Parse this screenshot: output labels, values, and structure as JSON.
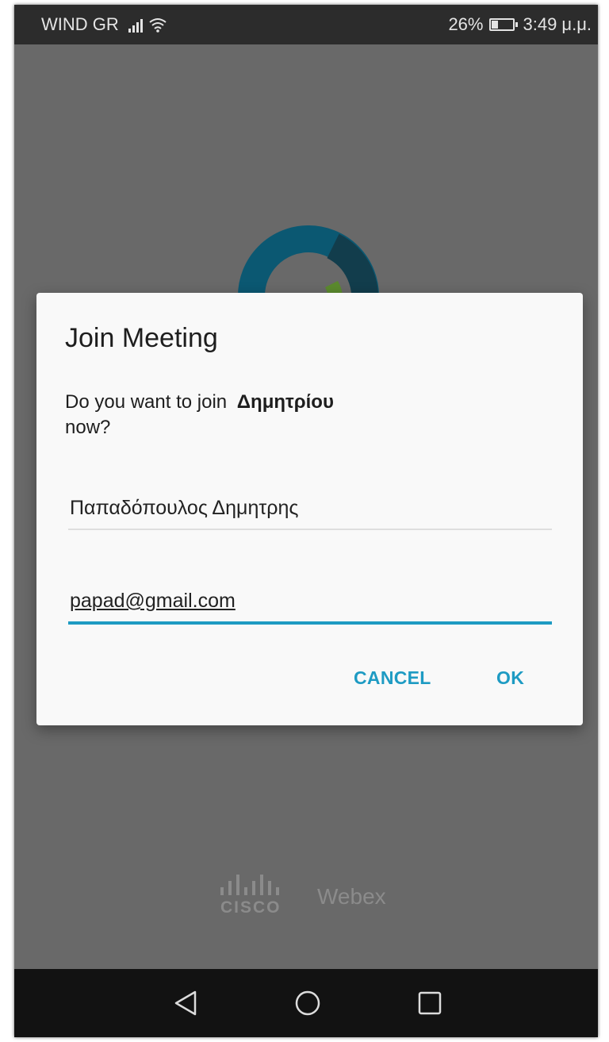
{
  "status_bar": {
    "carrier": "WIND GR",
    "battery_percent": "26%",
    "time": "3:49 μ.μ.",
    "icons": [
      "signal-icon",
      "wifi-icon",
      "battery-icon"
    ]
  },
  "dialog": {
    "title": "Join Meeting",
    "message_prefix": "Do you want to join",
    "meeting_name": "Δημητρίου",
    "message_suffix": "now?",
    "name_value": "Παπαδόπουλος Δημητρης",
    "email_value": "papad@gmail.com",
    "cancel_label": "CANCEL",
    "ok_label": "OK"
  },
  "footer": {
    "cisco_label": "CISCO",
    "webex_label": "Webex"
  },
  "nav_bar": {
    "icons": [
      "back-icon",
      "home-icon",
      "recents-icon"
    ]
  },
  "colors": {
    "accent": "#1e9bc3",
    "scrim": "#696969",
    "dialog_bg": "#f9f9f9",
    "status_bar": "#2c2c2c",
    "nav_bar": "#121212"
  }
}
